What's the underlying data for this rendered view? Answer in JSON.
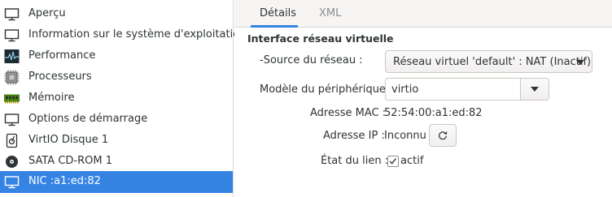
{
  "sidebar": {
    "items": [
      {
        "label": "Aperçu",
        "icon": "monitor-icon"
      },
      {
        "label": "Information sur le système d'exploitation",
        "icon": "monitor-icon"
      },
      {
        "label": "Performance",
        "icon": "performance-graph-icon"
      },
      {
        "label": "Processeurs",
        "icon": "cpu-chip-icon"
      },
      {
        "label": "Mémoire",
        "icon": "memory-module-icon"
      },
      {
        "label": "Options de démarrage",
        "icon": "boot-options-icon"
      },
      {
        "label": "VirtIO Disque 1",
        "icon": "hard-disk-icon"
      },
      {
        "label": "SATA CD-ROM 1",
        "icon": "cdrom-icon"
      },
      {
        "label": "NIC :a1:ed:82",
        "icon": "network-card-icon"
      }
    ],
    "selected_index": 8
  },
  "tabs": [
    {
      "label": "Détails"
    },
    {
      "label": "XML"
    }
  ],
  "details": {
    "section_title": "Interface réseau virtuelle",
    "source_label": "-Source du réseau :",
    "source_value": "Réseau virtuel 'default' : NAT (Inactif)",
    "model_label": "Modèle du périphérique :",
    "model_value": "virtio",
    "mac_label": "Adresse MAC :",
    "mac_value": "52:54:00:a1:ed:82",
    "ip_label": "Adresse IP :",
    "ip_value": "Inconnu",
    "link_label": "État du lien :",
    "link_checkbox_label": "actif",
    "link_active": true
  },
  "colors": {
    "selection": "#3584e4",
    "tab_bar": "#f6f5f4"
  }
}
